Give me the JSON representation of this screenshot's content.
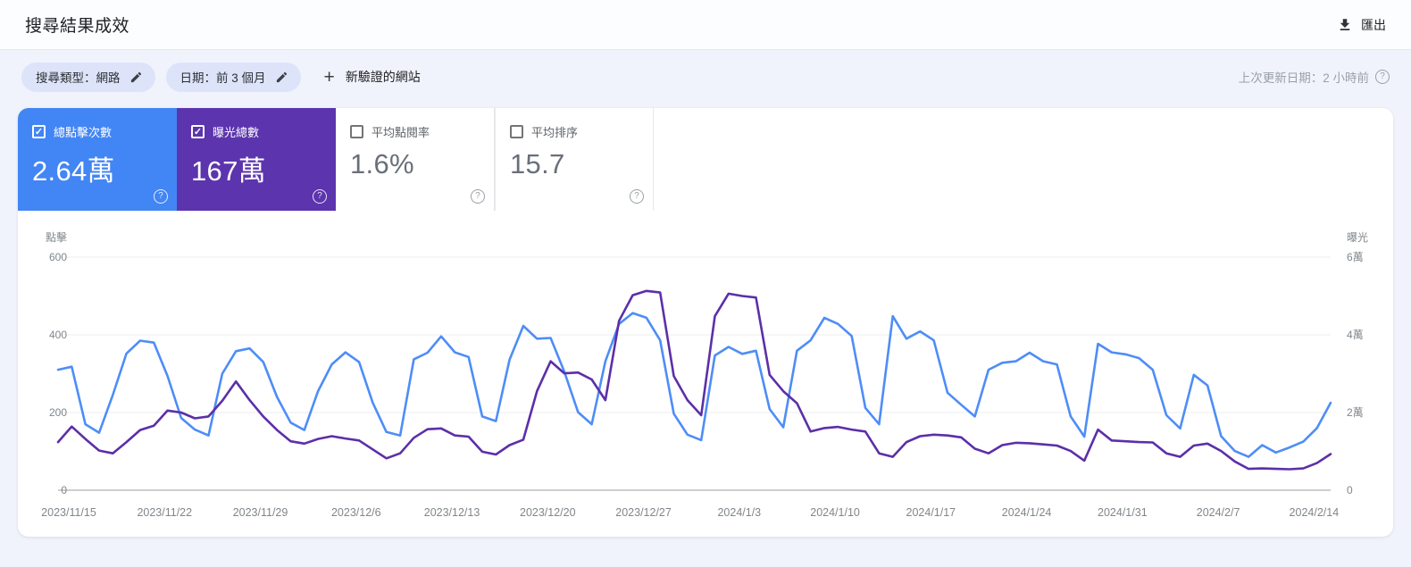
{
  "header": {
    "title": "搜尋結果成效",
    "export_label": "匯出"
  },
  "filters": {
    "search_type_chip": "搜尋類型：網路",
    "date_chip": "日期：前 3 個月",
    "new_site_label": "新驗證的網站",
    "last_updated": "上次更新日期：2 小時前"
  },
  "icons": {
    "plus": "+",
    "help": "?",
    "check": "✓"
  },
  "metrics": [
    {
      "label": "總點擊次數",
      "value": "2.64萬",
      "checked": true,
      "color": "#4285f4"
    },
    {
      "label": "曝光總數",
      "value": "167萬",
      "checked": true,
      "color": "#5c34ae"
    },
    {
      "label": "平均點閱率",
      "value": "1.6%",
      "checked": false,
      "color": "#ffffff"
    },
    {
      "label": "平均排序",
      "value": "15.7",
      "checked": false,
      "color": "#ffffff"
    }
  ],
  "chart_data": {
    "type": "line",
    "start_date": "2023/11/15",
    "frequency": "daily",
    "x_tick_labels": [
      "2023/11/15",
      "2023/11/22",
      "2023/11/29",
      "2023/12/6",
      "2023/12/13",
      "2023/12/20",
      "2023/12/27",
      "2024/1/3",
      "2024/1/10",
      "2024/1/17",
      "2024/1/24",
      "2024/1/31",
      "2024/2/7",
      "2024/2/14"
    ],
    "x_tick_indices": [
      0,
      7,
      14,
      21,
      28,
      35,
      42,
      49,
      56,
      63,
      70,
      77,
      84,
      91
    ],
    "left_axis": {
      "title": "點擊",
      "ticks": [
        "600",
        "400",
        "200",
        "0"
      ],
      "range": [
        0,
        600
      ]
    },
    "right_axis": {
      "title": "曝光",
      "ticks": [
        "6萬",
        "4萬",
        "2萬",
        "0"
      ],
      "range": [
        0,
        60000
      ]
    },
    "grid": true,
    "series": [
      {
        "name": "clicks",
        "color": "#4e8df7",
        "axis": "left",
        "values": [
          310,
          318,
          170,
          148,
          245,
          352,
          385,
          380,
          294,
          186,
          156,
          141,
          300,
          358,
          365,
          330,
          240,
          174,
          155,
          255,
          324,
          355,
          330,
          225,
          150,
          141,
          337,
          354,
          396,
          355,
          343,
          190,
          178,
          336,
          423,
          390,
          392,
          305,
          201,
          170,
          332,
          428,
          456,
          444,
          386,
          197,
          143,
          129,
          347,
          369,
          351,
          359,
          209,
          162,
          359,
          386,
          444,
          428,
          397,
          212,
          170,
          448,
          390,
          409,
          386,
          251,
          220,
          190,
          310,
          328,
          332,
          354,
          332,
          324,
          190,
          138,
          377,
          355,
          350,
          340,
          310,
          193,
          159,
          297,
          270,
          139,
          101,
          86,
          116,
          97,
          110,
          125,
          160,
          225
        ]
      },
      {
        "name": "impressions",
        "color": "#5c2fa8",
        "axis": "right",
        "values": [
          12400,
          16400,
          13200,
          10200,
          9500,
          12400,
          15500,
          16600,
          20500,
          20000,
          18500,
          19000,
          23000,
          28000,
          23200,
          19000,
          15500,
          12600,
          12000,
          13200,
          13900,
          13300,
          12800,
          10500,
          8200,
          9500,
          13500,
          15700,
          15900,
          14100,
          13800,
          9900,
          9200,
          11600,
          13000,
          25500,
          33200,
          30100,
          30300,
          28500,
          23200,
          43600,
          50200,
          51300,
          50900,
          29400,
          23200,
          19300,
          44800,
          50600,
          50000,
          49600,
          29700,
          25500,
          22400,
          15100,
          16000,
          16300,
          15600,
          15100,
          9500,
          8600,
          12400,
          13900,
          14300,
          14100,
          13600,
          10700,
          9500,
          11600,
          12200,
          12100,
          11800,
          11500,
          10100,
          7600,
          15600,
          12800,
          12600,
          12400,
          12300,
          9500,
          8600,
          11500,
          12000,
          10100,
          7400,
          5500,
          5600,
          5500,
          5400,
          5600,
          7000,
          9300
        ]
      }
    ]
  }
}
